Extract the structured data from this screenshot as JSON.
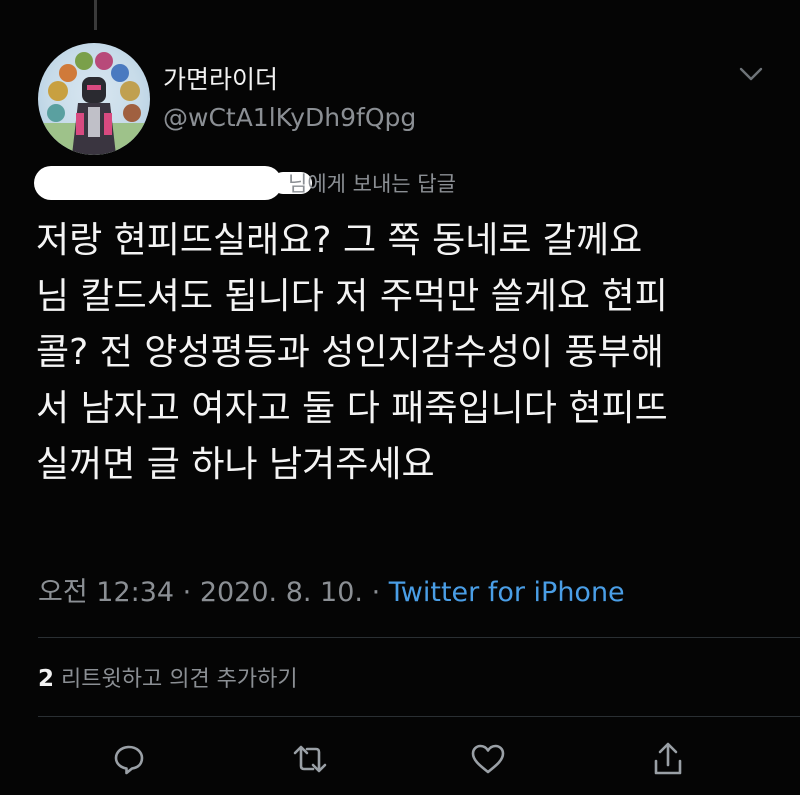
{
  "header": {
    "display_name": "가면라이더",
    "handle": "@wCtA1lKyDh9fQpg"
  },
  "reply": {
    "suffix": "님에게 보내는 답글"
  },
  "tweet": {
    "lines": [
      "저랑 현피뜨실래요? 그 쪽 동네로 갈께요",
      "님 칼드셔도 됩니다 저 주먹만 쓸게요 현피",
      "콜? 전 양성평등과 성인지감수성이 풍부해",
      "서 남자고 여자고 둘 다 패죽입니다 현피뜨",
      "실꺼면 글 하나 남겨주세요"
    ]
  },
  "meta": {
    "time": "오전 12:34",
    "sep1": " · ",
    "date": "2020. 8. 10.",
    "sep2": " · ",
    "source": "Twitter for iPhone"
  },
  "stats": {
    "retweet_count": "2",
    "retweet_label": " 리트윗하고 의견 추가하기"
  },
  "icons": {
    "reply": "comment-bubble-icon",
    "retweet": "retweet-icon",
    "like": "heart-icon",
    "share": "share-icon",
    "more": "chevron-down-icon"
  },
  "colors": {
    "background": "#050505",
    "text": "#f4f4f4",
    "muted": "#8b8f94",
    "link": "#4a9ee6"
  }
}
